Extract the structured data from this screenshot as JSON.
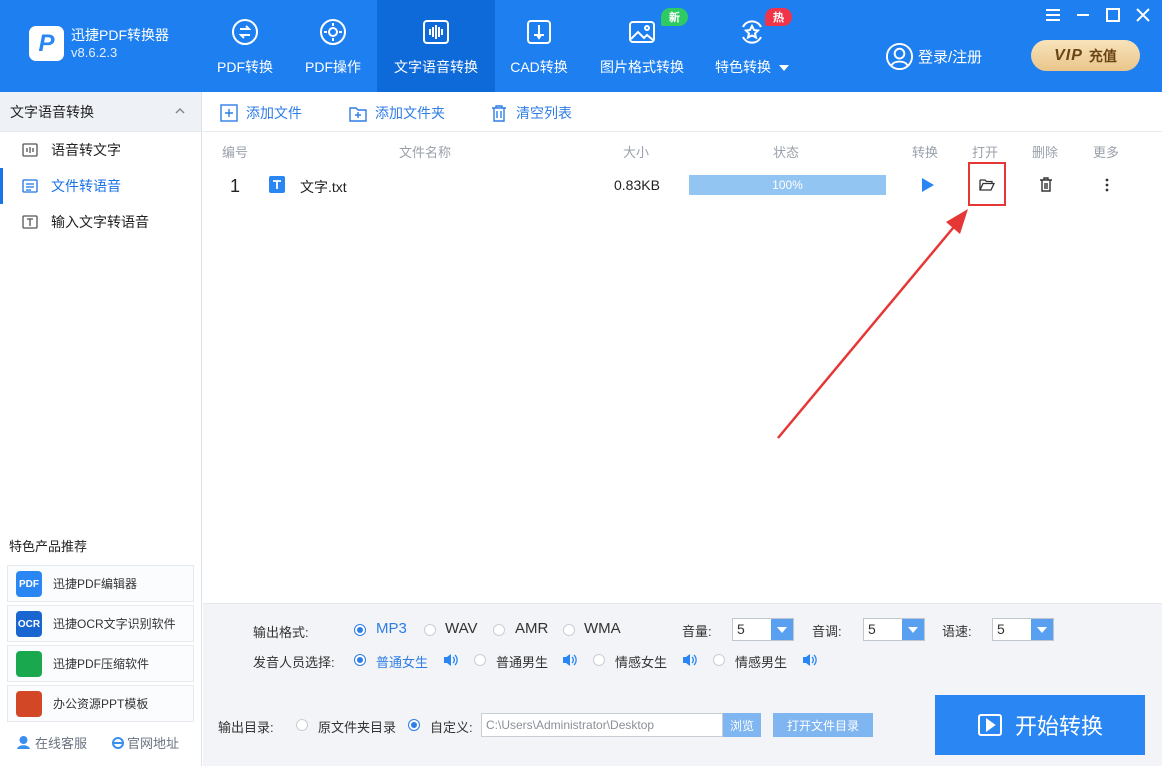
{
  "app": {
    "name": "迅捷PDF转换器",
    "version": "v8.6.2.3",
    "logo_letter": "P"
  },
  "nav": [
    {
      "label": "PDF转换",
      "icon": "pdf-convert-icon"
    },
    {
      "label": "PDF操作",
      "icon": "pdf-operate-icon"
    },
    {
      "label": "文字语音转换",
      "icon": "voice-icon",
      "active": true
    },
    {
      "label": "CAD转换",
      "icon": "cad-icon"
    },
    {
      "label": "图片格式转换",
      "icon": "image-icon",
      "badge": "新"
    },
    {
      "label": "特色转换",
      "icon": "feature-icon",
      "badge": "热"
    }
  ],
  "header": {
    "login": "登录/注册",
    "vip_mark": "VIP",
    "vip_text": "充值"
  },
  "sidebar": {
    "title": "文字语音转换",
    "items": [
      {
        "label": "语音转文字"
      },
      {
        "label": "文件转语音",
        "active": true
      },
      {
        "label": "输入文字转语音"
      }
    ],
    "recommend_title": "特色产品推荐",
    "recommend": [
      {
        "label": "迅捷PDF编辑器",
        "icon_text": "PDF"
      },
      {
        "label": "迅捷OCR文字识别软件",
        "icon_text": "OCR"
      },
      {
        "label": "迅捷PDF压缩软件",
        "icon_text": ""
      },
      {
        "label": "办公资源PPT模板",
        "icon_text": ""
      }
    ],
    "footer": {
      "service": "在线客服",
      "website": "官网地址"
    }
  },
  "toolbar": {
    "add_file": "添加文件",
    "add_folder": "添加文件夹",
    "clear": "清空列表"
  },
  "table": {
    "headers": {
      "no": "编号",
      "name": "文件名称",
      "size": "大小",
      "status": "状态",
      "convert": "转换",
      "open": "打开",
      "delete": "删除",
      "more": "更多"
    },
    "rows": [
      {
        "no": "1",
        "name": "文字.txt",
        "size": "0.83KB",
        "status": "100%",
        "progress": 1.0
      }
    ]
  },
  "settings": {
    "format_label": "输出格式:",
    "formats": [
      "MP3",
      "WAV",
      "AMR",
      "WMA"
    ],
    "selected_format": "MP3",
    "volume_label": "音量:",
    "volume": "5",
    "pitch_label": "音调:",
    "pitch": "5",
    "speed_label": "语速:",
    "speed": "5",
    "voice_label": "发音人员选择:",
    "voices": [
      "普通女生",
      "普通男生",
      "情感女生",
      "情感男生"
    ],
    "selected_voice": "普通女生",
    "output_label": "输出目录:",
    "output_original": "原文件夹目录",
    "output_custom": "自定义:",
    "output_path": "C:\\Users\\Administrator\\Desktop",
    "browse": "浏览",
    "open_dir": "打开文件目录",
    "start": "开始转换"
  },
  "colors": {
    "primary": "#1d7ff0",
    "accent": "#2f7de6",
    "annotation": "#e63737"
  }
}
